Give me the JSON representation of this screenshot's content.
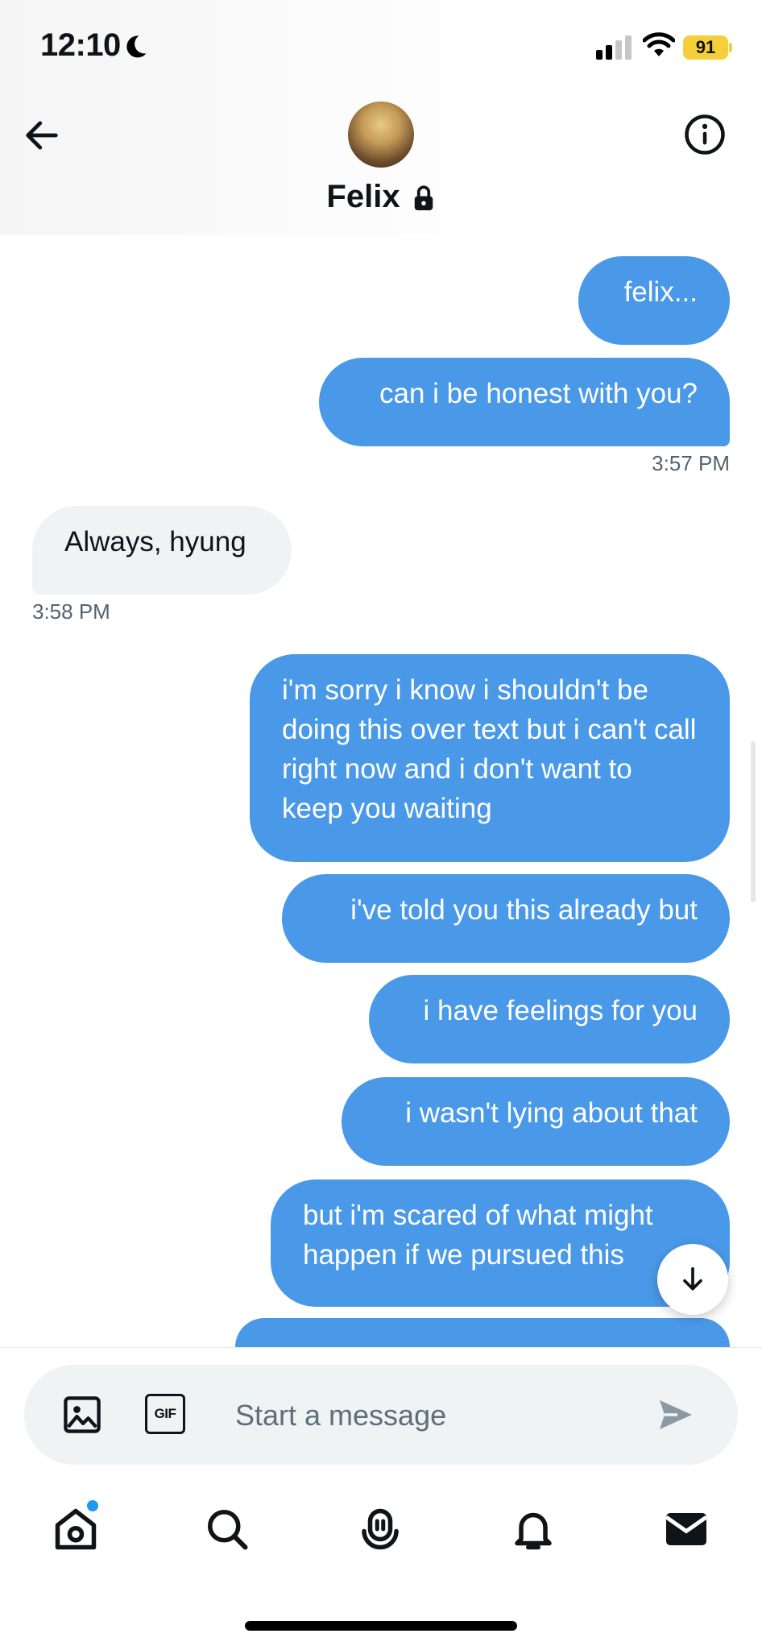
{
  "status_bar": {
    "time": "12:10",
    "battery": "91"
  },
  "header": {
    "contact_name": "Felix"
  },
  "messages": [
    {
      "text": "felix..."
    },
    {
      "text": "can i be honest with you?"
    },
    {
      "timestamp": "3:57 PM"
    },
    {
      "text": "Always, hyung"
    },
    {
      "timestamp": "3:58 PM"
    },
    {
      "text": "i'm sorry i know i shouldn't be doing this over text but i can't call right now and i don't want to keep you waiting"
    },
    {
      "text": "i've told you this already but"
    },
    {
      "text": "i have feelings for you"
    },
    {
      "text": "i wasn't lying about that"
    },
    {
      "text": "but i'm scared of what might happen if we pursued this"
    }
  ],
  "composer": {
    "placeholder": "Start a message",
    "gif_label": "GIF"
  },
  "colors": {
    "sent_bubble": "#4a99e9",
    "received_bubble": "#eff3f4",
    "accent": "#1d9bf0"
  },
  "icons": [
    "back-arrow-icon",
    "info-icon",
    "lock-icon",
    "image-icon",
    "gif-icon",
    "send-icon",
    "arrow-down-icon",
    "home-icon",
    "search-icon",
    "spaces-icon",
    "bell-icon",
    "mail-icon"
  ]
}
